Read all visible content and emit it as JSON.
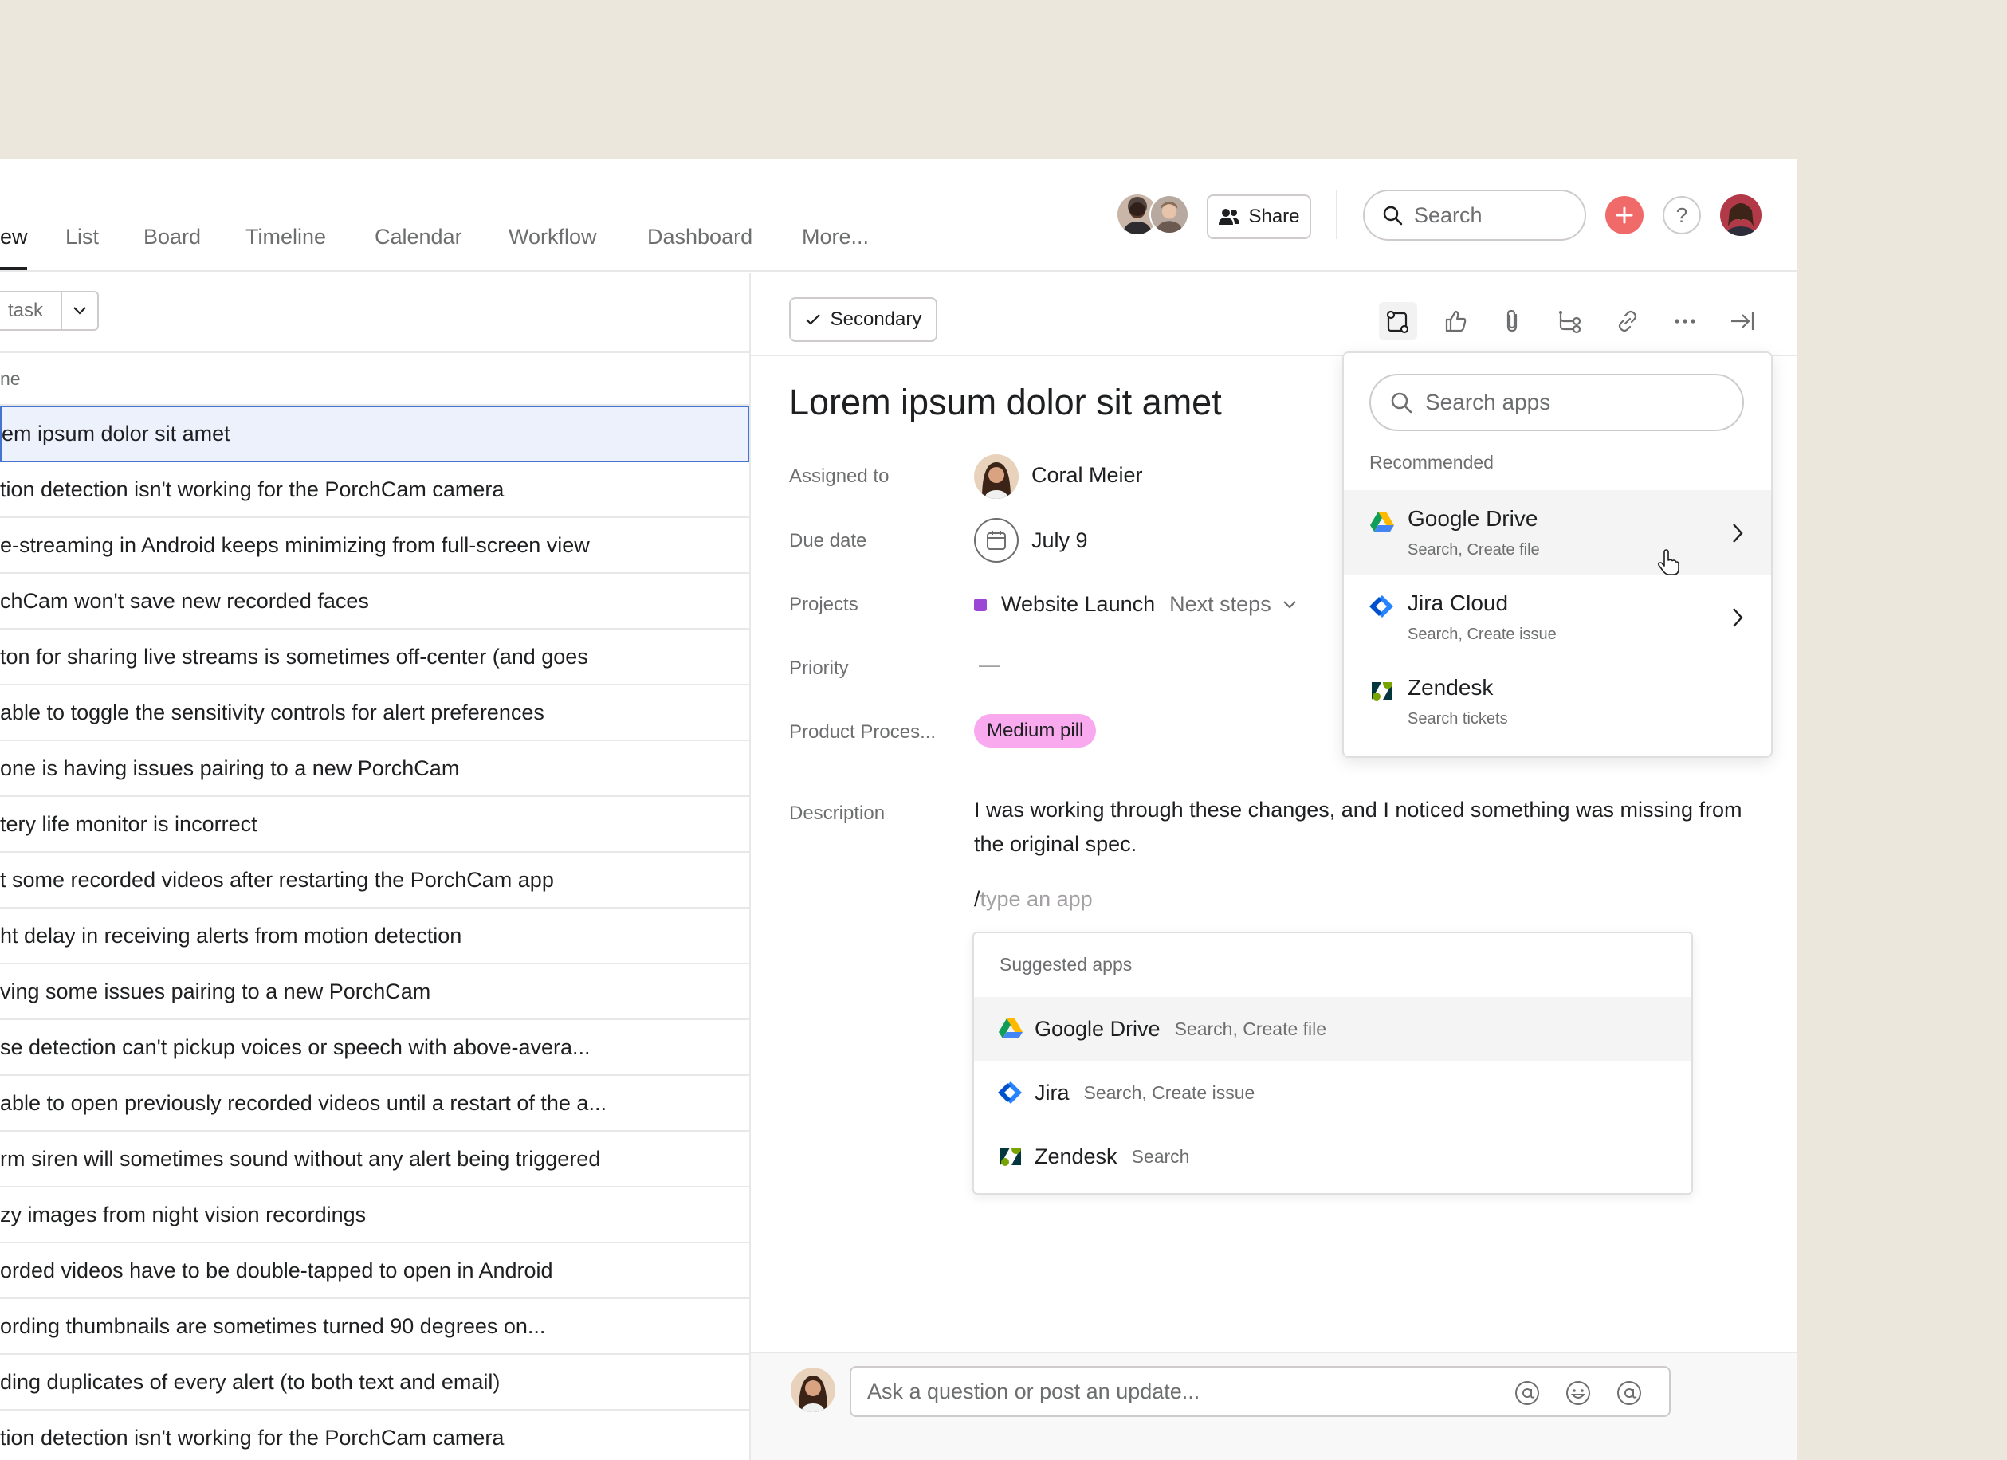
{
  "tabs": [
    "ew",
    "List",
    "Board",
    "Timeline",
    "Calendar",
    "Workflow",
    "Dashboard",
    "More..."
  ],
  "header": {
    "share_label": "Share",
    "search_placeholder": "Search",
    "add_symbol": "+",
    "help_symbol": "?"
  },
  "list": {
    "add_task_label": "task",
    "column_header": "ne",
    "rows": [
      "em ipsum dolor sit amet",
      "tion detection isn't working for the PorchCam camera",
      "e-streaming in Android keeps minimizing from full-screen view",
      "chCam won't save new recorded faces",
      "ton for sharing live streams is sometimes off-center (and goes",
      "able to toggle the sensitivity controls for alert preferences",
      "one is having issues pairing to a new PorchCam",
      "tery life monitor is incorrect",
      "t some recorded videos after restarting the PorchCam app",
      "ht delay in receiving alerts from motion detection",
      "ving some issues pairing to a new PorchCam",
      "se detection can't pickup voices or speech with above-avera...",
      "able to open previously recorded videos until a restart of the a...",
      "rm siren will sometimes sound without any alert being triggered",
      "zy images from night vision recordings",
      "orded videos have to be double-tapped to open in Android",
      "ording thumbnails are sometimes turned 90 degrees on...",
      "ding duplicates of every alert (to both text and email)",
      "tion detection isn't working for the PorchCam camera"
    ]
  },
  "detail": {
    "secondary_label": "Secondary",
    "title": "Lorem ipsum dolor sit amet",
    "fields": {
      "assigned_label": "Assigned to",
      "assignee": "Coral Meier",
      "due_label": "Due date",
      "due_value": "July 9",
      "projects_label": "Projects",
      "project_name": "Website Launch",
      "project_section": "Next steps",
      "priority_label": "Priority",
      "priority_value": "—",
      "product_label": "Product Proces...",
      "product_pill": "Medium pill",
      "description_label": "Description"
    },
    "description_text": "I was working through these changes, and I noticed something was missing from the original spec.",
    "slash": "/",
    "slash_placeholder": "type an app",
    "suggested": {
      "title": "Suggested apps",
      "items": [
        {
          "name": "Google Drive",
          "desc": "Search, Create file"
        },
        {
          "name": "Jira",
          "desc": "Search, Create issue"
        },
        {
          "name": "Zendesk",
          "desc": "Search"
        }
      ]
    },
    "apps_popover": {
      "search_placeholder": "Search apps",
      "section_title": "Recommended",
      "items": [
        {
          "name": "Google Drive",
          "desc": "Search, Create file"
        },
        {
          "name": "Jira Cloud",
          "desc": "Search, Create issue"
        },
        {
          "name": "Zendesk",
          "desc": "Search tickets"
        }
      ]
    },
    "comment_placeholder": "Ask a question or post an update..."
  },
  "colors": {
    "accent_red": "#f06a6a",
    "selection_blue": "#4573d2",
    "pill_pink": "#f9aaef",
    "project_purple": "#9b46d5"
  }
}
